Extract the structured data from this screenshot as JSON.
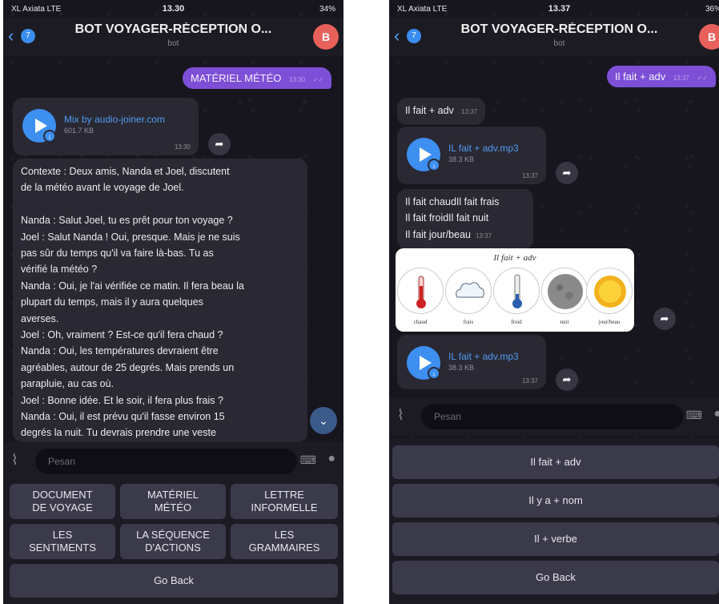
{
  "left": {
    "status": {
      "carrier": "XL Axiata  LTE",
      "time": "13.30",
      "battery": "34%"
    },
    "header": {
      "back_badge": "7",
      "title": "BOT VOYAGER-RÉCEPTION O...",
      "subtitle": "bot",
      "avatar": "B"
    },
    "out_message": {
      "text": "MATÉRIEL MÉTÉO",
      "time": "13:30"
    },
    "audio": {
      "name": "Mix by audio-joiner.com",
      "size": "601.7 KB",
      "time": "13:30"
    },
    "transcript": {
      "lines": [
        "Contexte : Deux amis, Nanda et Joel, discutent",
        "de la météo avant le voyage de Joel.",
        "",
        "Nanda : Salut Joel, tu es prêt pour ton voyage ?",
        "Joel : Salut Nanda ! Oui, presque. Mais je ne suis",
        "pas sûr du temps qu'il va faire là-bas. Tu as",
        "vérifié la météo ?",
        "Nanda : Oui, je l'ai vérifiée ce matin. Il fera beau la",
        "plupart du temps, mais il y aura quelques",
        "averses.",
        "Joel : Oh, vraiment ? Est-ce qu'il fera chaud ?",
        "Nanda : Oui, les températures devraient être",
        "agréables, autour de 25 degrés. Mais prends un",
        "parapluie, au cas où.",
        "Joel : Bonne idée. Et le soir, il fera plus frais ?",
        "Nanda : Oui, il est prévu qu'il fasse environ 15",
        "degrés la nuit. Tu devrais prendre une veste"
      ]
    },
    "input_placeholder": "Pesan",
    "keyboard": {
      "rows": [
        [
          "DOCUMENT\nDE VOYAGE",
          "MATÉRIEL\nMÉTÉO",
          "LETTRE\nINFORMELLE"
        ],
        [
          "LES\nSENTIMENTS",
          "LA SÉQUENCE\nD'ACTIONS",
          "LES\nGRAMMAIRES"
        ]
      ],
      "go_back": "Go Back"
    }
  },
  "right": {
    "status": {
      "carrier": "XL Axiata  LTE",
      "time": "13.37",
      "battery": "36%"
    },
    "header": {
      "back_badge": "7",
      "title": "BOT VOYAGER-RÉCEPTION O...",
      "subtitle": "bot",
      "avatar": "B"
    },
    "out_message": {
      "text": "Il fait + adv",
      "time": "13:37"
    },
    "in_text": {
      "text": "Il fait + adv",
      "time": "13:37"
    },
    "audio1": {
      "name": "IL fait + adv.mp3",
      "size": "38.3 KB",
      "time": "13:37"
    },
    "phrases": {
      "lines": [
        "Il fait chaudIl fait frais",
        "Il fait froidIl fait nuit",
        "Il fait jour/beau"
      ],
      "time": "13:37"
    },
    "weather_card": {
      "title": "Il fait + adv",
      "items": [
        {
          "label": "chaud",
          "icon": "thermometer-hot-icon"
        },
        {
          "label": "frais",
          "icon": "cloud-icon"
        },
        {
          "label": "froid",
          "icon": "thermometer-cold-icon"
        },
        {
          "label": "nuit",
          "icon": "moon-icon"
        },
        {
          "label": "jour/beau",
          "icon": "sun-icon"
        }
      ]
    },
    "audio2": {
      "name": "IL fait + adv.mp3",
      "size": "38.3 KB",
      "time": "13:37"
    },
    "input_placeholder": "Pesan",
    "keyboard": {
      "buttons": [
        "Il fait + adv",
        "Il y a + nom",
        "Il + verbe",
        "Go Back"
      ]
    }
  }
}
